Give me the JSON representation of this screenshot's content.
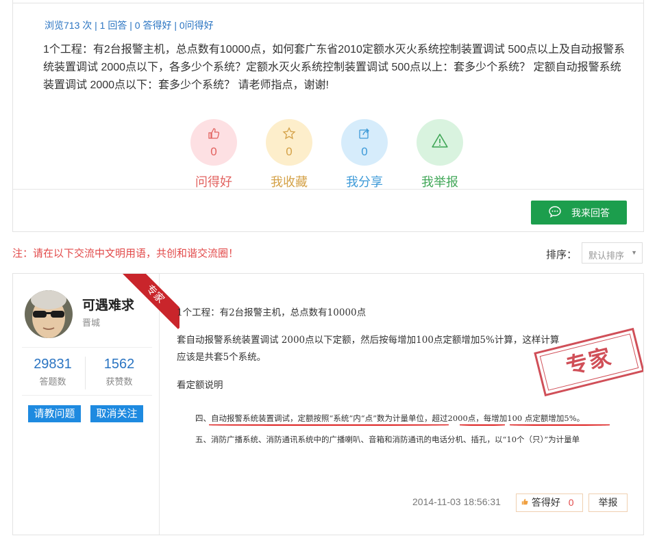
{
  "question": {
    "stats": {
      "views": "浏览713 次",
      "answers": "1 回答",
      "good_answers": "0 答得好",
      "good_questions": "0问得好"
    },
    "text": "1个工程：有2台报警主机，总点数有10000点，如何套广东省2010定额水灭火系统控制装置调试 500点以上及自动报警系统装置调试 2000点以下，各多少个系统？定额水灭火系统控制装置调试 500点以上：套多少个系统？ 定额自动报警系统装置调试 2000点以下：套多少个系统？ 请老师指点，谢谢!",
    "actions": [
      {
        "icon": "thumbs-up-icon",
        "count": "0",
        "label": "问得好"
      },
      {
        "icon": "star-icon",
        "count": "0",
        "label": "我收藏"
      },
      {
        "icon": "share-icon",
        "count": "0",
        "label": "我分享"
      },
      {
        "icon": "warning-icon",
        "label": "我举报"
      }
    ],
    "answer_button": "我来回答"
  },
  "notice": "注：请在以下交流中文明用语，共创和谐交流圈！",
  "sort": {
    "label": "排序：",
    "selected": "默认排序"
  },
  "answer": {
    "user": {
      "name": "可遇难求",
      "location": "晋城",
      "badge": "专家",
      "answers_count": "29831",
      "answers_caption": "答题数",
      "likes_count": "1562",
      "likes_caption": "获赞数",
      "ask_button": "请教问题",
      "unfollow_button": "取消关注"
    },
    "paragraphs": [
      "1个工程：有2台报警主机，总点数有10000点",
      "套自动报警系统装置调试 2000点以下定额，然后按每增加100点定额增加5%计算，这样计算",
      "应该是共套5个系统。",
      "看定额说明"
    ],
    "stamp": "专家",
    "doc_lines": [
      "四、自动报警系统装置调试，定额按照“系统”内“点”数为计量单位，超过2000点，每增加100 点定额增加5%。",
      "五、消防广播系统、消防通讯系统中的广播喇叭、音箱和消防通讯的电话分机、插孔，以“10个（只）”为计量单"
    ],
    "time": "2014-11-03 18:56:31",
    "good_label": "答得好",
    "good_count": "0",
    "report_label": "举报"
  },
  "colors": {
    "link_blue": "#2a74c2",
    "green": "#1c9e4d",
    "red": "#e24a4a",
    "badge_red": "#c9252b",
    "button_blue": "#1e8ae0"
  }
}
